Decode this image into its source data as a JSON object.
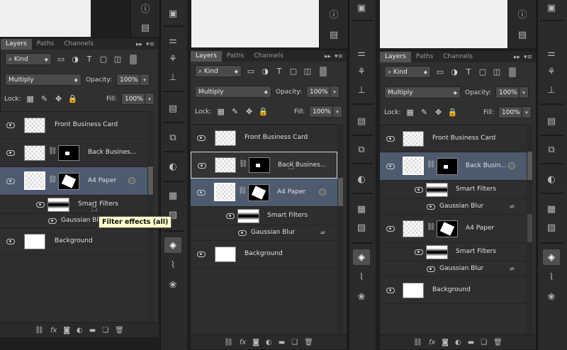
{
  "tabs": {
    "layers": "Layers",
    "paths": "Paths",
    "channels": "Channels",
    "menu_arrows": "▸▸"
  },
  "filter": {
    "kind": "Kind"
  },
  "blend": {
    "mode": "Multiply",
    "opacity_label": "Opacity:",
    "opacity_value": "100%"
  },
  "lock": {
    "label": "Lock:",
    "fill_label": "Fill:",
    "fill_value": "100%"
  },
  "panels": [
    {
      "layers": [
        {
          "name": "Front Business Card"
        },
        {
          "name": "Back Busines..."
        },
        {
          "name": "A4 Paper"
        },
        {
          "name": "Smart Filters"
        },
        {
          "name": "Gaussian Blur"
        },
        {
          "name": "Background"
        }
      ]
    },
    {
      "layers": [
        {
          "name": "Front Business Card"
        },
        {
          "name": "Back Busines..."
        },
        {
          "name": "A4 Paper"
        },
        {
          "name": "Smart Filters"
        },
        {
          "name": "Gaussian Blur"
        },
        {
          "name": "Background"
        }
      ]
    },
    {
      "layers": [
        {
          "name": "Front Business Card"
        },
        {
          "name": "Back Busin..."
        },
        {
          "name": "Smart Filters"
        },
        {
          "name": "Gaussian Blur"
        },
        {
          "name": "A4 Paper"
        },
        {
          "name": "Smart Filters"
        },
        {
          "name": "Gaussian Blur"
        },
        {
          "name": "Background"
        }
      ]
    }
  ],
  "tooltip": "Filter effects (all)",
  "bottom_icons": [
    "link-icon",
    "fx-icon",
    "mask-icon",
    "adjustment-icon",
    "folder-icon",
    "new-layer-icon",
    "trash-icon"
  ],
  "colors": {
    "selected": "#4e5a6e",
    "panel": "#303030"
  }
}
